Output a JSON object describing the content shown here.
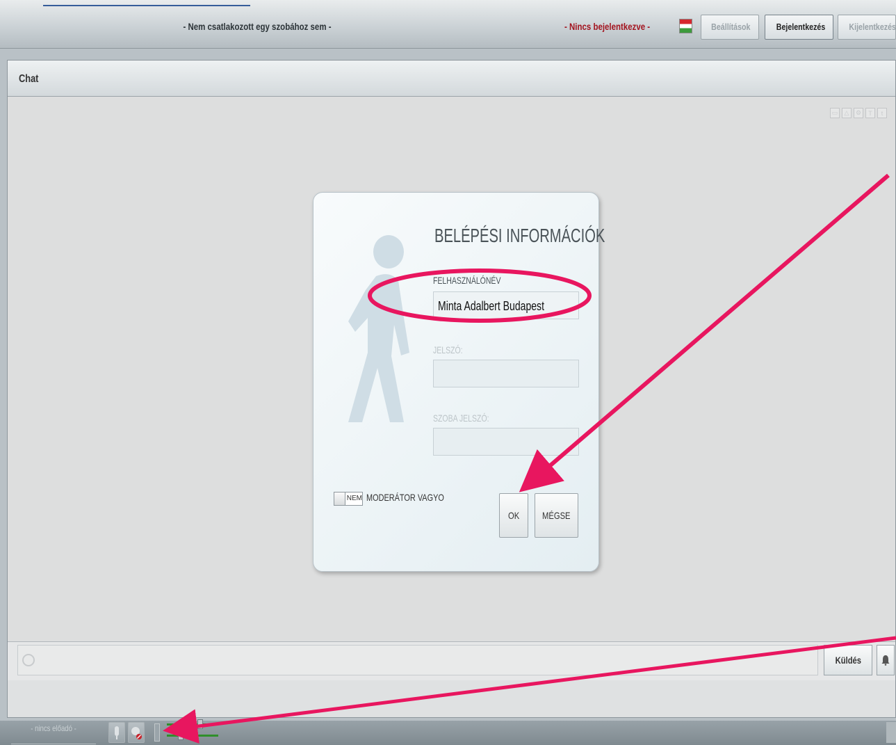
{
  "topbar": {
    "room_status": "- Nem csatlakozott egy szobához sem -",
    "login_status": "- Nincs bejelentkezve -",
    "flag_icon": "hungarian-flag",
    "settings_label": "Beállítások",
    "login_label": "Bejelentkezés",
    "logout_label": "Kijelentkezés"
  },
  "chat": {
    "title": "Chat",
    "toolbar_icons": [
      "chat-icon",
      "bell-icon",
      "gear-icon",
      "text-size-up-icon",
      "text-size-down-icon"
    ]
  },
  "dialog": {
    "title": "BELÉPÉSI INFORMÁCIÓK",
    "username_label": "FELHASZNÁLÓNÉV",
    "username_value": "Minta Adalbert Budapest",
    "password_label": "JELSZÓ:",
    "room_password_label": "SZOBA JELSZÓ:",
    "toggle_label": "NEM",
    "moderator_label": "MODERÁTOR VAGYO",
    "ok_label": "OK",
    "cancel_label": "MÉGSE"
  },
  "input_row": {
    "send_label": "Küldés"
  },
  "bottombar": {
    "presenter_label": "- nincs előadó -"
  },
  "colors": {
    "accent_red": "#a3141f",
    "annotation_pink": "#e8165f",
    "slider_green": "#2f8f2a"
  }
}
